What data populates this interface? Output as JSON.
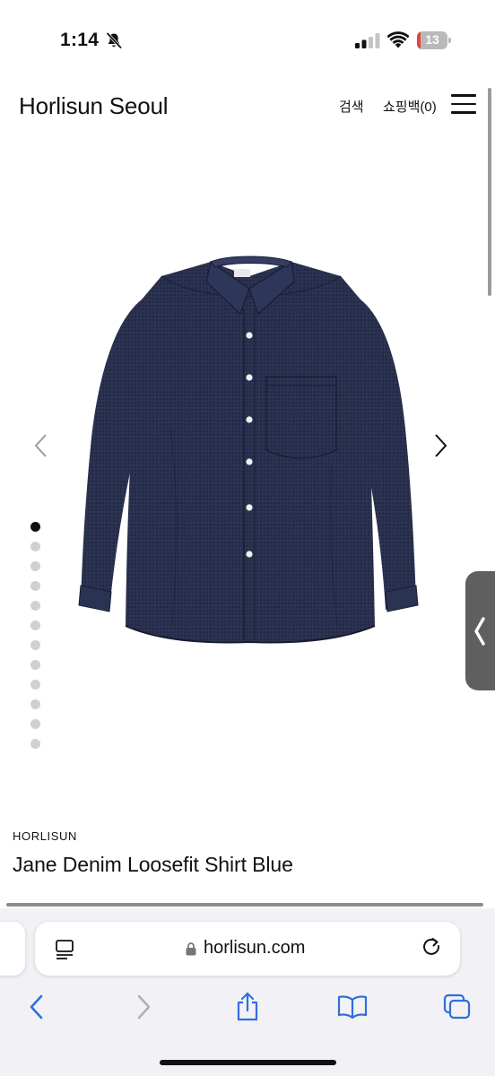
{
  "status_bar": {
    "time": "1:14",
    "battery_level": "13",
    "battery_fraction": 0.13,
    "icons": [
      "bell-slash-icon",
      "signal-icon",
      "wifi-icon",
      "battery-icon"
    ]
  },
  "header": {
    "brand": "Horlisun Seoul",
    "search_label": "검색",
    "bag_label": "쇼핑백(0)",
    "menu_icon": "hamburger-menu-icon"
  },
  "gallery": {
    "image": "navy denim long-sleeve shirt",
    "prev_icon": "chevron-left-icon",
    "next_icon": "chevron-right-icon",
    "slide_count": 12,
    "active_slide": 1
  },
  "product": {
    "brand": "HORLISUN",
    "title": "Jane Denim Loosefit Shirt Blue"
  },
  "browser": {
    "url": "horlisun.com",
    "icons": [
      "reader-icon",
      "lock-icon",
      "reload-icon",
      "back-icon",
      "forward-icon",
      "share-icon",
      "bookmarks-icon",
      "tabs-icon"
    ],
    "accent_color": "#2f6fde"
  }
}
